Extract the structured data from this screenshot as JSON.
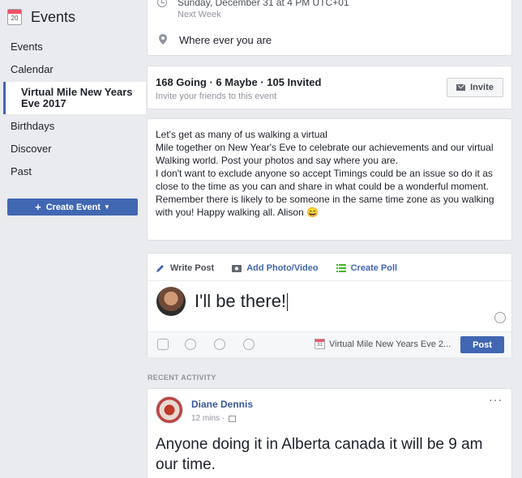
{
  "sidebar": {
    "calendar_day": "20",
    "title": "Events",
    "items": [
      {
        "label": "Events"
      },
      {
        "label": "Calendar"
      },
      {
        "label": "Virtual Mile New Years Eve 2017",
        "active": true
      },
      {
        "label": "Birthdays"
      },
      {
        "label": "Discover"
      },
      {
        "label": "Past"
      }
    ],
    "create_button": "Create Event"
  },
  "event": {
    "date_text": "Sunday, December 31 at 4 PM UTC+01",
    "date_sub": "Next Week",
    "location": "Where ever you are",
    "going_summary": "168 Going · 6 Maybe · 105 Invited",
    "invite_prompt": "Invite your friends to this event",
    "invite_button": "Invite",
    "description": "Let's get as many of us walking a virtual\nMile together on New Year's Eve to celebrate our achievements and our virtual\nWalking world. Post your photos and say where you are.\nI don't want to exclude anyone so accept Timings could be an issue so do it as close to the time as you can and share in what could be a wonderful moment. Remember there is likely to be someone in the same time zone as you walking with you! Happy walking all. Alison 😄"
  },
  "composer": {
    "tabs": [
      {
        "label": "Write Post",
        "icon": "pencil-icon"
      },
      {
        "label": "Add Photo/Video",
        "icon": "camera-icon"
      },
      {
        "label": "Create Poll",
        "icon": "list-icon"
      }
    ],
    "input_value": "I'll be there!",
    "event_tag": "Virtual Mile New Years Eve 2...",
    "mini_cal_day": "31",
    "post_button": "Post"
  },
  "recent_activity": {
    "label": "RECENT ACTIVITY",
    "post": {
      "author": "Diane Dennis",
      "time": "12 mins",
      "more": "···",
      "body": "Anyone doing it in Alberta canada it will be 9 am our time."
    }
  },
  "colors": {
    "accent": "#4267b2",
    "link": "#365899",
    "background": "#e9ebee"
  }
}
